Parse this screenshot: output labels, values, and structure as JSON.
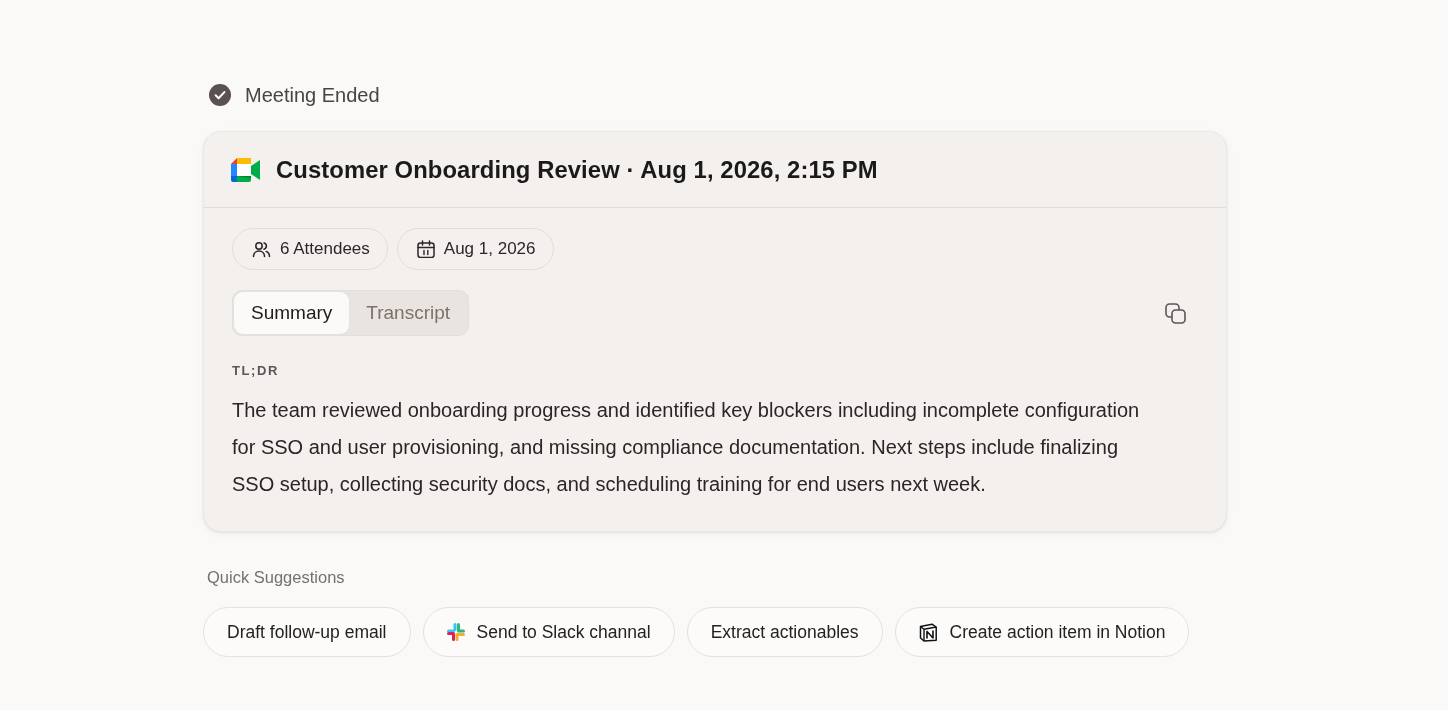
{
  "status": {
    "label": "Meeting Ended"
  },
  "meeting": {
    "title": "Customer Onboarding Review · Aug 1, 2026, 2:15 PM",
    "chips": [
      {
        "kind": "people",
        "label": "6 Attendees"
      },
      {
        "kind": "date",
        "label": "Aug 1, 2026"
      }
    ],
    "tabs": [
      {
        "label": "Summary",
        "selected": true
      },
      {
        "label": "Transcript",
        "selected": false
      }
    ],
    "section_label": "TL;DR",
    "summary": "The team reviewed onboarding progress and identified key blockers including incomplete configuration for SSO and user provisioning, and missing compliance documentation. Next steps include finalizing SSO setup, collecting security docs, and scheduling training for end users next week."
  },
  "quick_suggestions": {
    "label": "Quick Suggestions",
    "items": [
      {
        "kind": "plain",
        "label": "Draft follow-up email"
      },
      {
        "kind": "chat",
        "label": "Send to Slack channal"
      },
      {
        "kind": "plain",
        "label": "Extract actionables"
      },
      {
        "kind": "notes",
        "label": "Create action item in Notion"
      }
    ]
  }
}
